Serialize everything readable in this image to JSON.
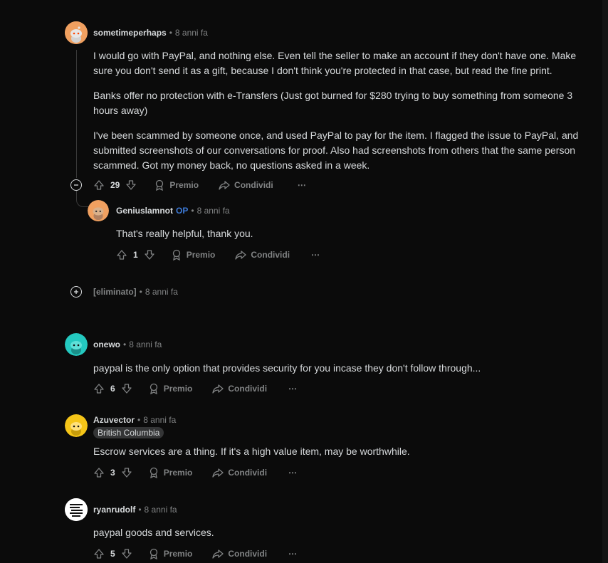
{
  "comments": [
    {
      "author": "sometimeperhaps",
      "time": "8 anni fa",
      "paragraphs": [
        "I would go with PayPal, and nothing else. Even tell the seller to make an account if they don't have one. Make sure you don't send it as a gift, because I don't think you're protected in that case, but read the fine print.",
        "Banks offer no protection with e-Transfers (Just got burned for $280 trying to buy something from someone 3 hours away)",
        "I've been scammed by someone once, and used PayPal to pay for the item. I flagged the issue to PayPal, and submitted screenshots of our conversations for proof. Also had screenshots from others that the same person scammed. Got my money back, no questions asked in a week."
      ],
      "score": "29"
    },
    {
      "author": "Geniuslamnot",
      "op": "OP",
      "time": "8 anni fa",
      "text": "That's really helpful, thank you.",
      "score": "1"
    },
    {
      "author": "[eliminato]",
      "time": "8 anni fa"
    },
    {
      "author": "onewo",
      "time": "8 anni fa",
      "text": "paypal is the only option that provides security for you incase they don't follow through...",
      "score": "6"
    },
    {
      "author": "Azuvector",
      "time": "8 anni fa",
      "flair": "British Columbia",
      "text": "Escrow services are a thing. If it's a high value item, may be worthwhile.",
      "score": "3"
    },
    {
      "author": "ryanrudolf",
      "time": "8 anni fa",
      "text": "paypal goods and services.",
      "score": "5"
    }
  ],
  "actions": {
    "award": "Premio",
    "share": "Condividi",
    "more": "⋯"
  },
  "colors": {
    "background": "#0b0b0b",
    "text": "#d7dadc",
    "muted": "#818384",
    "op": "#3d7bd9",
    "avatar_orange": "#f0a060",
    "avatar_teal": "#24c9c0",
    "avatar_yellow": "#f5c518"
  },
  "icons": [
    "upvote-icon",
    "downvote-icon",
    "award-icon",
    "share-icon",
    "more-icon",
    "collapse-icon",
    "expand-icon"
  ]
}
